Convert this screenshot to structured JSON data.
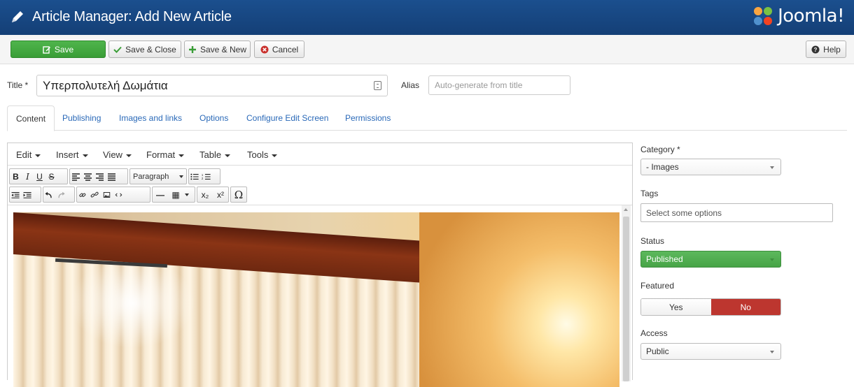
{
  "header": {
    "title": "Article Manager: Add New Article",
    "brand": "Joomla!",
    "icons": {
      "edit": "pencil-icon",
      "brand": "joomla-logo-icon"
    }
  },
  "toolbar": {
    "save_label": "Save",
    "save_close_label": "Save & Close",
    "save_new_label": "Save & New",
    "cancel_label": "Cancel",
    "help_label": "Help",
    "colors": {
      "save": "#46a743",
      "cancel_icon": "#c9302c"
    }
  },
  "form": {
    "title_label": "Title *",
    "title_value": "Υπερπολυτελή Δωμάτια",
    "alias_label": "Alias",
    "alias_placeholder": "Auto-generate from title"
  },
  "tabs": [
    {
      "label": "Content",
      "active": true
    },
    {
      "label": "Publishing"
    },
    {
      "label": "Images and links"
    },
    {
      "label": "Options"
    },
    {
      "label": "Configure Edit Screen"
    },
    {
      "label": "Permissions"
    }
  ],
  "editor": {
    "menus": [
      "Edit",
      "Insert",
      "View",
      "Format",
      "Table",
      "Tools"
    ],
    "row1": {
      "format_buttons": [
        "B",
        "I",
        "U",
        "S"
      ],
      "align_icons": [
        "align-left-icon",
        "align-center-icon",
        "align-right-icon",
        "align-justify-icon"
      ],
      "paragraph_select": "Paragraph",
      "list_icons": [
        "bullet-list-icon",
        "numbered-list-icon"
      ]
    },
    "row2": {
      "indent_icons": [
        "outdent-icon",
        "indent-icon"
      ],
      "history_icons": [
        "undo-icon",
        "redo-icon"
      ],
      "link_icons": [
        "link-icon",
        "unlink-icon",
        "image-icon",
        "code-icon"
      ],
      "hr_glyph": "—",
      "table_glyph": "▦",
      "sub_glyph": "x₂",
      "sup_glyph": "x²",
      "omega_glyph": "Ω"
    }
  },
  "sidebar": {
    "category_label": "Category *",
    "category_value": "- Images",
    "tags_label": "Tags",
    "tags_placeholder": "Select some options",
    "status_label": "Status",
    "status_value": "Published",
    "featured_label": "Featured",
    "featured_yes": "Yes",
    "featured_no": "No",
    "featured_selected": "No",
    "access_label": "Access",
    "access_value": "Public",
    "colors": {
      "published": "#54b254",
      "no_active": "#bd362f"
    }
  }
}
